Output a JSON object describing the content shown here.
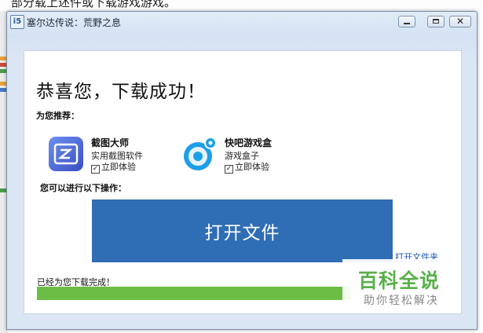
{
  "background": {
    "top_text": "部分载上述件或下载游戏游戏。"
  },
  "window": {
    "icon_glyph": "i5",
    "title": "塞尔达传说：荒野之息",
    "min_button_glyph": "",
    "max_button_glyph": "",
    "close_button_glyph": "✕"
  },
  "main": {
    "headline": "恭喜您，下载成功！",
    "recommend_label": "为您推荐：",
    "apps": [
      {
        "name": "截图大师",
        "desc": "实用截图软件",
        "check_label": "立即体验",
        "checked": true,
        "icon": "screenshot-master-icon",
        "color": "#4d6dd6"
      },
      {
        "name": "快吧游戏盒",
        "desc": "游戏盒子",
        "check_label": "立即体验",
        "checked": true,
        "icon": "kuaiba-game-box-icon",
        "color": "#1e9ee8"
      }
    ],
    "ops_label": "您可以进行以下操作：",
    "open_file_label": "打开文件",
    "open_folder_label": "打开文件夹",
    "done_text": "已经为您下载完成！",
    "progress_fraction": 1.0
  },
  "watermark": {
    "main": "百科全说",
    "sub": "助你轻松解决"
  },
  "colors": {
    "accent_blue": "#2f6db5",
    "progress_green": "#6cbd45",
    "link_blue": "#1a56b8",
    "watermark_green": "#5ab04b"
  }
}
